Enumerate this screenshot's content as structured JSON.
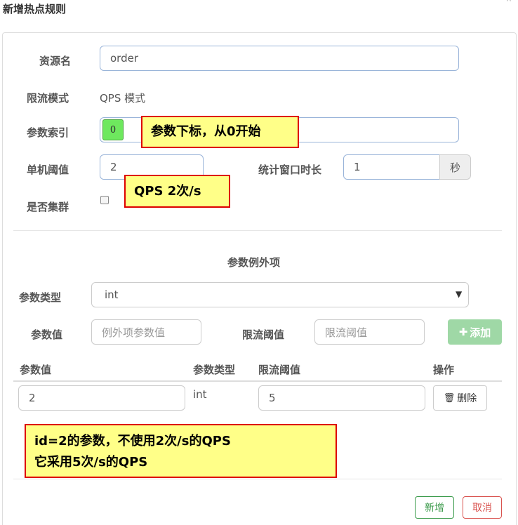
{
  "dialog": {
    "title": "新增热点规则",
    "close": "˄"
  },
  "form": {
    "resource_label": "资源名",
    "resource_value": "order",
    "mode_label": "限流模式",
    "mode_value": "QPS 模式",
    "index_label": "参数索引",
    "index_value": "0",
    "threshold_label": "单机阈值",
    "threshold_value": "2",
    "window_label": "统计窗口时长",
    "window_value": "1",
    "window_unit": "秒",
    "cluster_label": "是否集群"
  },
  "annotations": {
    "index_note": "参数下标，从0开始",
    "qps_note": "QPS   2次/s",
    "exception_note_line1": "id=2的参数，不使用2次/s的QPS",
    "exception_note_line2": "它采用5次/s的QPS"
  },
  "exceptions": {
    "section_title": "参数例外项",
    "type_label": "参数类型",
    "type_selected": "int",
    "value_label": "参数值",
    "value_placeholder": "例外项参数值",
    "limit_label": "限流阈值",
    "limit_placeholder": "限流阈值",
    "add_button": "添加",
    "columns": [
      "参数值",
      "参数类型",
      "限流阈值",
      "操作"
    ],
    "rows": [
      {
        "value": "2",
        "type": "int",
        "limit": "5",
        "action": "删除"
      }
    ]
  },
  "footer": {
    "save": "新增",
    "cancel": "取消"
  },
  "colors": {
    "note_bg": "#ffff88",
    "note_border": "#dd0000",
    "save": "#3a9a4a",
    "cancel": "#d9534f"
  }
}
